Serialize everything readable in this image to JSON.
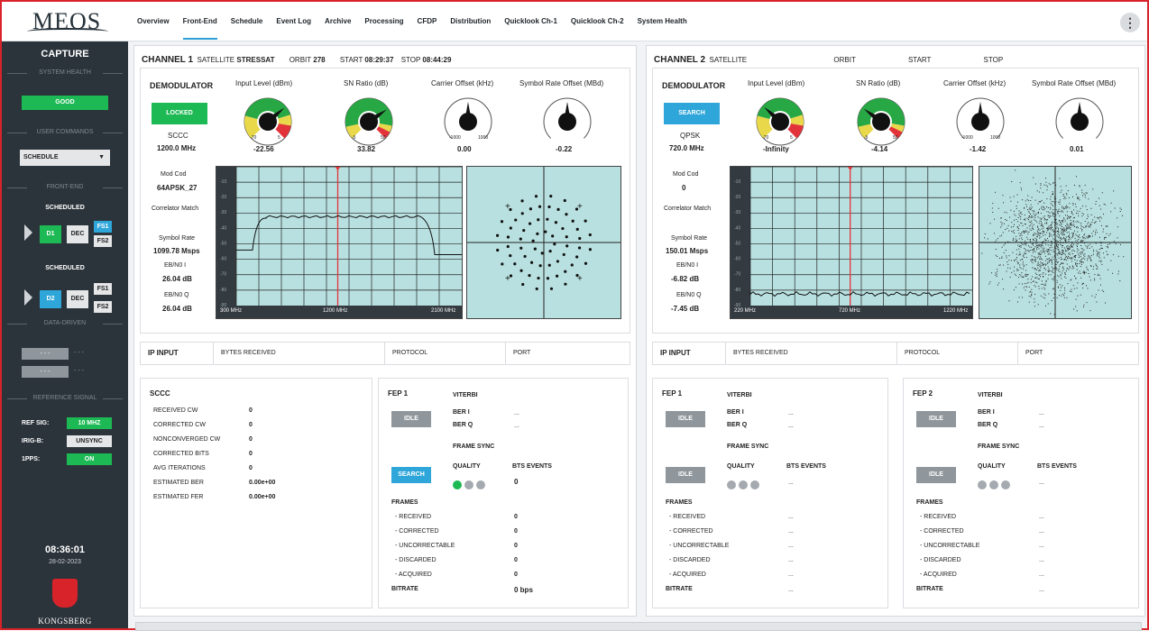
{
  "nav": {
    "items": [
      "Overview",
      "Front-End",
      "Schedule",
      "Event Log",
      "Archive",
      "Processing",
      "CFDP",
      "Distribution",
      "Quicklook Ch-1",
      "Quicklook Ch-2",
      "System Health"
    ],
    "active": "Front-End"
  },
  "logo": "MEOS",
  "sidebar": {
    "title": "CAPTURE",
    "system_health": {
      "section": "SYSTEM HEALTH",
      "status": "GOOD"
    },
    "user_commands": {
      "section": "USER COMMANDS",
      "select_value": "SCHEDULE"
    },
    "front_end": {
      "section": "FRONT-END",
      "d1": {
        "state": "SCHEDULED",
        "label": "D1",
        "dec": "DEC",
        "fs1": "FS1",
        "fs2": "FS2"
      },
      "d2": {
        "state": "SCHEDULED",
        "label": "D2",
        "dec": "DEC",
        "fs1": "FS1",
        "fs2": "FS2"
      }
    },
    "data_driven": {
      "section": "DATA-DRIVEN",
      "row1": "- - -",
      "row1b": "- - -",
      "row2": "- - -",
      "row2b": "- - -"
    },
    "reference": {
      "section": "REFERENCE SIGNAL",
      "ref_sig_label": "REF SIG:",
      "ref_sig": "10 MHZ",
      "irig_label": "IRIG-B:",
      "irig": "UNSYNC",
      "pps_label": "1PPS:",
      "pps": "ON"
    },
    "clock": "08:36:01",
    "date": "28-02-2023",
    "company": "KONGSBERG"
  },
  "ch1": {
    "title": "CHANNEL 1",
    "sat_label": "SATELLITE",
    "sat": "STRESSAT",
    "orbit_label": "ORBIT",
    "orbit": "278",
    "start_label": "START",
    "start": "08:29:37",
    "stop_label": "STOP",
    "stop": "08:44:29",
    "demod_label": "DEMODULATOR",
    "lock_btn": "LOCKED",
    "coding": "SCCC",
    "freq": "1200.0 MHz",
    "input_label": "Input Level (dBm)",
    "input_val": "-22.56",
    "input_min": "-70",
    "input_max": "5",
    "snr_label": "SN Ratio (dB)",
    "snr_val": "33.82",
    "snr_min": "-5",
    "snr_max": "50",
    "carrier_label": "Carrier Offset (kHz)",
    "carrier_val": "0.00",
    "carrier_min": "-1000",
    "carrier_max": "1000",
    "symoff_label": "Symbol Rate Offset (MBd)",
    "symoff_val": "-0.22",
    "modcod_label": "Mod Cod",
    "modcod": "64APSK_27",
    "corr_label": "Correlator Match",
    "symrate_label": "Symbol Rate",
    "symrate": "1099.78 Msps",
    "ebn0i_label": "EB/N0 I",
    "ebn0i": "26.04 dB",
    "ebn0q_label": "EB/N0 Q",
    "ebn0q": "26.04 dB",
    "spec_left": "300 MHz",
    "spec_mid": "1200 MHz",
    "spec_right": "2100 MHz",
    "ip_input": "IP INPUT",
    "bytes": "BYTES RECEIVED",
    "protocol": "PROTOCOL",
    "port": "PORT",
    "sccc": {
      "title": "SCCC",
      "rows": [
        {
          "k": "RECEIVED CW",
          "v": "0"
        },
        {
          "k": "CORRECTED CW",
          "v": "0"
        },
        {
          "k": "NONCONVERGED CW",
          "v": "0"
        },
        {
          "k": "CORRECTED BITS",
          "v": "0"
        },
        {
          "k": "AVG ITERATIONS",
          "v": "0"
        },
        {
          "k": "ESTIMATED BER",
          "v": "0.00e+00"
        },
        {
          "k": "ESTIMATED FER",
          "v": "0.00e+00"
        }
      ]
    },
    "fep": {
      "title": "FEP 1",
      "viterbi": "VITERBI",
      "idle": "IDLE",
      "ber_i": "BER I",
      "ber_i_v": "...",
      "ber_q": "BER Q",
      "ber_q_v": "...",
      "frame_sync": "FRAME SYNC",
      "search": "SEARCH",
      "quality": "QUALITY",
      "bts": "BTS EVENTS",
      "bts_v": "0",
      "frames": "FRAMES",
      "rows": [
        {
          "k": "- RECEIVED",
          "v": "0"
        },
        {
          "k": "- CORRECTED",
          "v": "0"
        },
        {
          "k": "- UNCORRECTABLE",
          "v": "0"
        },
        {
          "k": "- DISCARDED",
          "v": "0"
        },
        {
          "k": "- ACQUIRED",
          "v": "0"
        }
      ],
      "bitrate": "BITRATE",
      "bitrate_v": "0 bps"
    }
  },
  "ch2": {
    "title": "CHANNEL 2",
    "sat_label": "SATELLITE",
    "orbit_label": "ORBIT",
    "start_label": "START",
    "stop_label": "STOP",
    "demod_label": "DEMODULATOR",
    "lock_btn": "SEARCH",
    "coding": "QPSK",
    "freq": "720.0 MHz",
    "input_label": "Input Level (dBm)",
    "input_val": "-Infinity",
    "input_min": "-70",
    "input_max": "5",
    "snr_label": "SN Ratio (dB)",
    "snr_val": "-4.14",
    "snr_min": "-5",
    "snr_max": "50",
    "carrier_label": "Carrier Offset (kHz)",
    "carrier_val": "-1.42",
    "carrier_min": "-1000",
    "carrier_max": "1000",
    "symoff_label": "Symbol Rate Offset (MBd)",
    "symoff_val": "0.01",
    "modcod_label": "Mod Cod",
    "modcod": "0",
    "corr_label": "Correlator Match",
    "symrate_label": "Symbol Rate",
    "symrate": "150.01 Msps",
    "ebn0i_label": "EB/N0 I",
    "ebn0i": "-6.82 dB",
    "ebn0q_label": "EB/N0 Q",
    "ebn0q": "-7.45 dB",
    "spec_left": "220 MHz",
    "spec_mid": "720 MHz",
    "spec_right": "1220 MHz",
    "ip_input": "IP INPUT",
    "bytes": "BYTES RECEIVED",
    "protocol": "PROTOCOL",
    "port": "PORT",
    "fep1": {
      "title": "FEP 1",
      "viterbi": "VITERBI",
      "idle": "IDLE",
      "ber_i": "BER I",
      "ber_i_v": "...",
      "ber_q": "BER Q",
      "ber_q_v": "...",
      "frame_sync": "FRAME SYNC",
      "idle2": "IDLE",
      "quality": "QUALITY",
      "bts": "BTS EVENTS",
      "bts_v": "...",
      "frames": "FRAMES",
      "rows": [
        {
          "k": "- RECEIVED",
          "v": "..."
        },
        {
          "k": "- CORRECTED",
          "v": "..."
        },
        {
          "k": "- UNCORRECTABLE",
          "v": "..."
        },
        {
          "k": "- DISCARDED",
          "v": "..."
        },
        {
          "k": "- ACQUIRED",
          "v": "..."
        }
      ],
      "bitrate": "BITRATE",
      "bitrate_v": "..."
    },
    "fep2": {
      "title": "FEP 2",
      "viterbi": "VITERBI",
      "idle": "IDLE",
      "ber_i": "BER I",
      "ber_i_v": "...",
      "ber_q": "BER Q",
      "ber_q_v": "...",
      "frame_sync": "FRAME SYNC",
      "idle2": "IDLE",
      "quality": "QUALITY",
      "bts": "BTS EVENTS",
      "bts_v": "...",
      "frames": "FRAMES",
      "rows": [
        {
          "k": "- RECEIVED",
          "v": "..."
        },
        {
          "k": "- CORRECTED",
          "v": "..."
        },
        {
          "k": "- UNCORRECTABLE",
          "v": "..."
        },
        {
          "k": "- DISCARDED",
          "v": "..."
        },
        {
          "k": "- ACQUIRED",
          "v": "..."
        }
      ],
      "bitrate": "BITRATE",
      "bitrate_v": "..."
    }
  },
  "colors": {
    "green": "#1db954",
    "blue": "#2fa6d9",
    "gray": "#8f969c",
    "scope_bg": "#b9e0e0",
    "dark": "#2c343b",
    "red": "#d8232a"
  }
}
